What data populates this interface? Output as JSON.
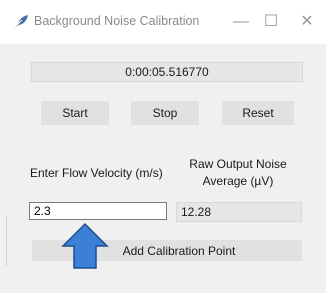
{
  "window": {
    "title": "Background Noise Calibration",
    "minimize_glyph": "—",
    "maximize_glyph": "☐",
    "close_glyph": "✕"
  },
  "timer": {
    "value": "0:00:05.516770"
  },
  "controls": {
    "start_label": "Start",
    "stop_label": "Stop",
    "reset_label": "Reset"
  },
  "velocity": {
    "label": "Enter Flow Velocity (m/s)",
    "value": "2.3"
  },
  "noise": {
    "label_line1": "Raw Output Noise",
    "label_line2": "Average (µV)",
    "value": "12.28"
  },
  "add_point": {
    "label": "Add Calibration Point"
  },
  "colors": {
    "arrow_fill": "#3b7fd6",
    "arrow_stroke": "#1f4e8c"
  },
  "icons": {
    "app": "feather-icon",
    "annotation": "up-arrow-icon"
  }
}
